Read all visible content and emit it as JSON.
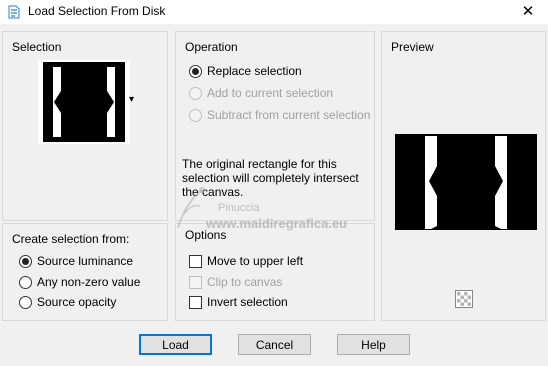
{
  "window": {
    "title": "Load Selection From Disk",
    "close_glyph": "✕"
  },
  "selection": {
    "title": "Selection",
    "dropdown_glyph": "▾"
  },
  "operation": {
    "title": "Operation",
    "options": [
      {
        "label": "Replace selection",
        "selected": true,
        "enabled": true
      },
      {
        "label": "Add to current selection",
        "selected": false,
        "enabled": false
      },
      {
        "label": "Subtract from current selection",
        "selected": false,
        "enabled": false
      }
    ],
    "message": "The original rectangle for this selection will completely intersect the canvas."
  },
  "preview": {
    "title": "Preview"
  },
  "create_from": {
    "title": "Create selection from:",
    "options": [
      {
        "label": "Source luminance",
        "selected": true
      },
      {
        "label": "Any non-zero value",
        "selected": false
      },
      {
        "label": "Source opacity",
        "selected": false
      }
    ]
  },
  "options": {
    "title": "Options",
    "items": [
      {
        "label": "Move to upper left",
        "checked": false,
        "enabled": true
      },
      {
        "label": "Clip to canvas",
        "checked": false,
        "enabled": false
      },
      {
        "label": "Invert selection",
        "checked": false,
        "enabled": true
      }
    ]
  },
  "buttons": {
    "load": "Load",
    "cancel": "Cancel",
    "help": "Help"
  },
  "watermark": {
    "name": "Pinuccia",
    "url": "www.maidiregrafica.eu"
  }
}
